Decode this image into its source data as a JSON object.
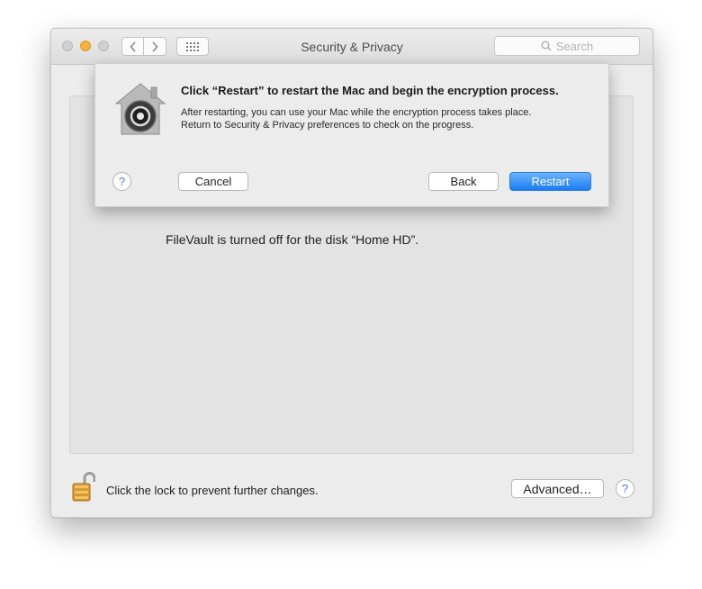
{
  "window": {
    "title": "Security & Privacy"
  },
  "search": {
    "placeholder": "Search"
  },
  "main": {
    "filevault_status": "FileVault is turned off for the disk “Home HD”."
  },
  "footer": {
    "lock_text": "Click the lock to prevent further changes.",
    "advanced_label": "Advanced…",
    "help_label": "?"
  },
  "sheet": {
    "heading": "Click “Restart” to restart the Mac and begin the encryption process.",
    "body_line1": "After restarting, you can use your Mac while the encryption process takes place.",
    "body_line2": "Return to Security & Privacy preferences to check on the progress.",
    "help_label": "?",
    "cancel_label": "Cancel",
    "back_label": "Back",
    "restart_label": "Restart"
  },
  "colors": {
    "accent": "#1a7cf5",
    "minimize": "#f5b33a",
    "help": "#3b82e6"
  },
  "icons": [
    "close-light",
    "minimize-light",
    "zoom-light",
    "chevron-left-icon",
    "chevron-right-icon",
    "grid-icon",
    "search-icon",
    "filevault-icon",
    "padlock-open-icon",
    "help-icon"
  ]
}
